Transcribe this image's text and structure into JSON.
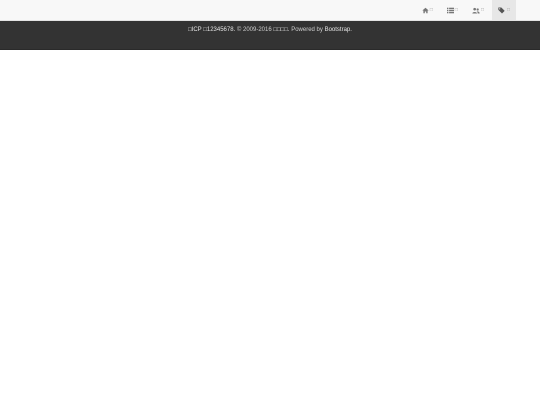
{
  "navbar": {
    "items": [
      {
        "icon": "home-icon",
        "label": "□"
      },
      {
        "icon": "list-icon",
        "label": "□"
      },
      {
        "icon": "users-icon",
        "label": "□"
      },
      {
        "icon": "tags-icon",
        "label": "□",
        "active": true
      }
    ]
  },
  "footer": {
    "icp": "□ICP □12345678.",
    "copyright": "© 2009-2016",
    "site": "□□□□.",
    "powered_prefix": "Powered by",
    "powered_link": "Bootstrap."
  },
  "colors": {
    "navbar_bg": "#f8f8f8",
    "nav_active_bg": "#e7e7e7",
    "footer_bg": "#333333",
    "footer_text": "#cfcfcf"
  }
}
